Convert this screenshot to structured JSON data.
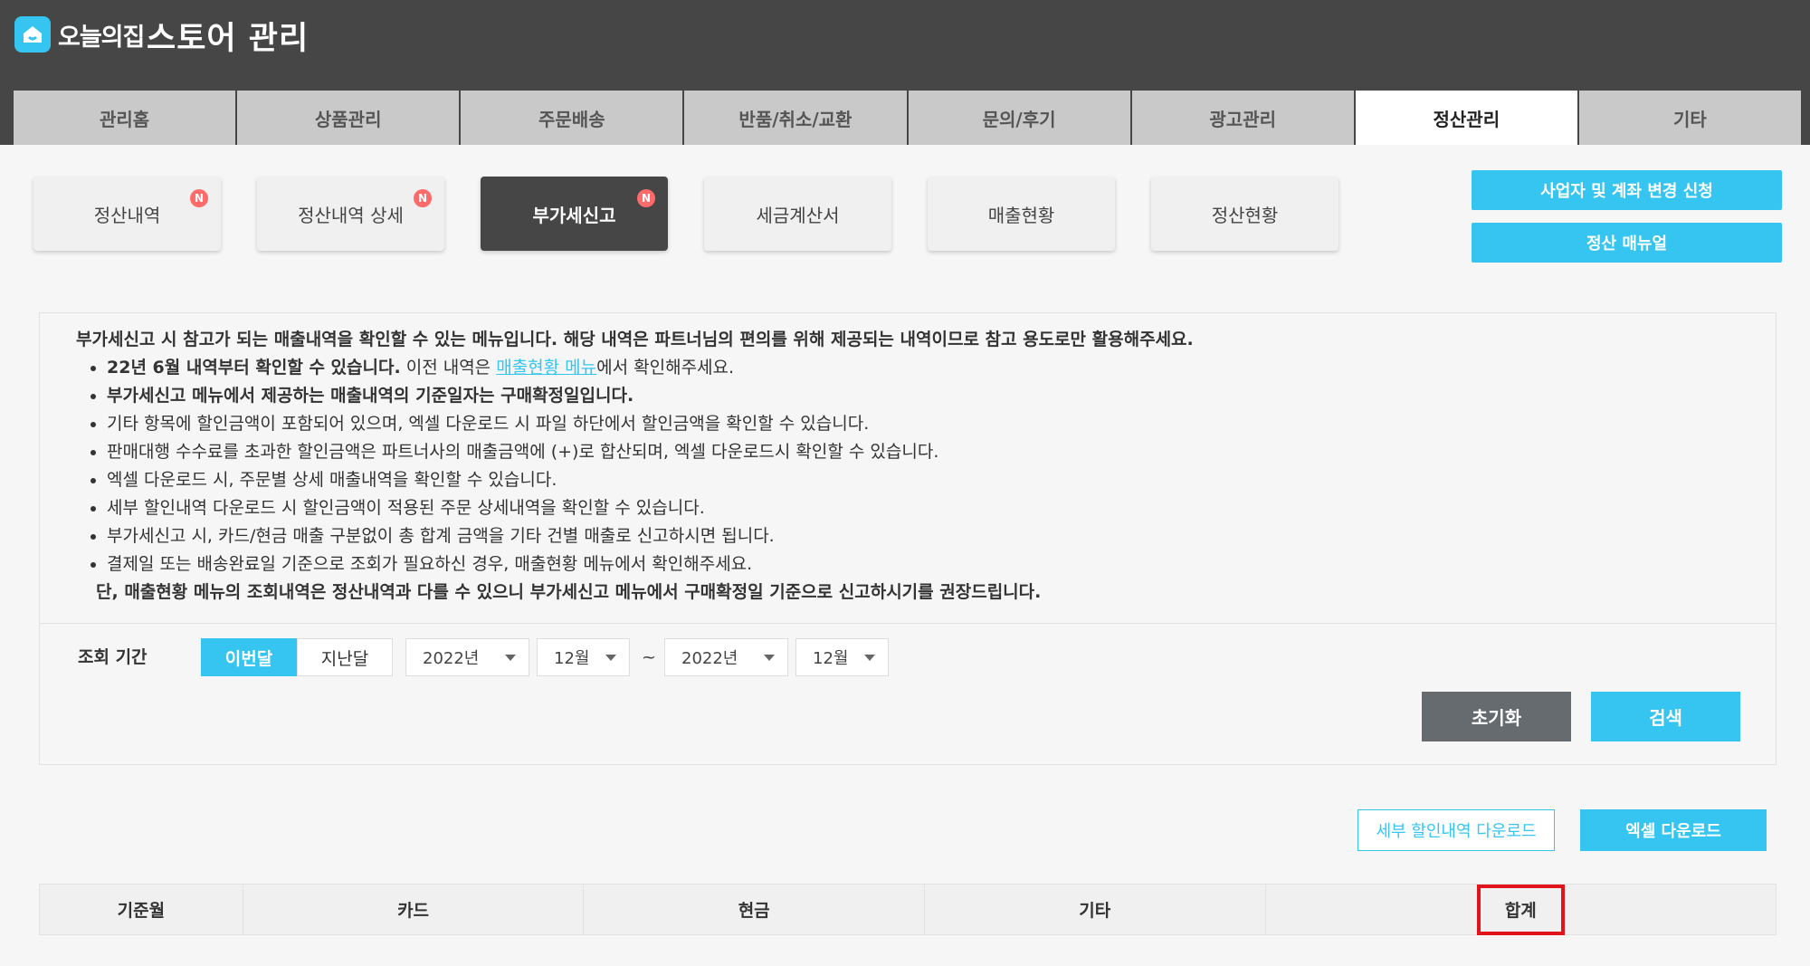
{
  "header": {
    "logo": "오늘의집",
    "title": "스토어 관리"
  },
  "tabs": [
    "관리홈",
    "상품관리",
    "주문배송",
    "반품/취소/교환",
    "문의/후기",
    "광고관리",
    "정산관리",
    "기타"
  ],
  "active_tab": "정산관리",
  "subtabs": [
    {
      "label": "정산내역",
      "badge": "N"
    },
    {
      "label": "정산내역 상세",
      "badge": "N"
    },
    {
      "label": "부가세신고",
      "badge": "N"
    },
    {
      "label": "세금계산서"
    },
    {
      "label": "매출현황"
    },
    {
      "label": "정산현황"
    }
  ],
  "side_buttons": {
    "change_request": "사업자 및 계좌 변경 신청",
    "manual": "정산 매뉴얼"
  },
  "notice": {
    "heading": "부가세신고 시 참고가 되는 매출내역을 확인할 수 있는 메뉴입니다. 해당 내역은 파트너님의 편의를 위해 제공되는 내역이므로 참고 용도로만 활용해주세요.",
    "line1_bold": "22년 6월 내역부터 확인할 수 있습니다.",
    "line1_pre": " 이전 내역은 ",
    "line1_link": "매출현황 메뉴",
    "line1_post": "에서 확인해주세요.",
    "line2": "부가세신고 메뉴에서 제공하는 매출내역의 기준일자는 구매확정일입니다.",
    "line3": "기타 항목에 할인금액이 포함되어 있으며, 엑셀 다운로드 시 파일 하단에서 할인금액을 확인할 수 있습니다.",
    "line4": "판매대행 수수료를 초과한 할인금액은 파트너사의 매출금액에 (+)로 합산되며, 엑셀 다운로드시 확인할 수 있습니다.",
    "line5": "엑셀 다운로드 시, 주문별 상세 매출내역을 확인할 수 있습니다.",
    "line6": "세부 할인내역 다운로드 시 할인금액이 적용된 주문 상세내역을 확인할 수 있습니다.",
    "line7": "부가세신고 시, 카드/현금 매출 구분없이 총 합계 금액을 기타 건별 매출로 신고하시면 됩니다.",
    "line8": "결제일 또는 배송완료일 기준으로 조회가 필요하신 경우, 매출현황 메뉴에서 확인해주세요.",
    "footer": "단, 매출현황 메뉴의 조회내역은 정산내역과 다를 수 있으니 부가세신고 메뉴에서 구매확정일 기준으로 신고하시기를 권장드립니다."
  },
  "filter": {
    "label": "조회 기간",
    "this_month": "이번달",
    "last_month": "지난달",
    "from_year": "2022년",
    "from_month": "12월",
    "separator": "~",
    "to_year": "2022년",
    "to_month": "12월",
    "reset": "초기화",
    "search": "검색"
  },
  "downloads": {
    "detail": "세부 할인내역 다운로드",
    "excel": "엑셀 다운로드"
  },
  "table": {
    "columns": [
      "기준월",
      "카드",
      "현금",
      "기타",
      "합계"
    ]
  },
  "colors": {
    "accent": "#35c5f0",
    "header_bg": "#464646",
    "highlight": "#e1141b"
  }
}
